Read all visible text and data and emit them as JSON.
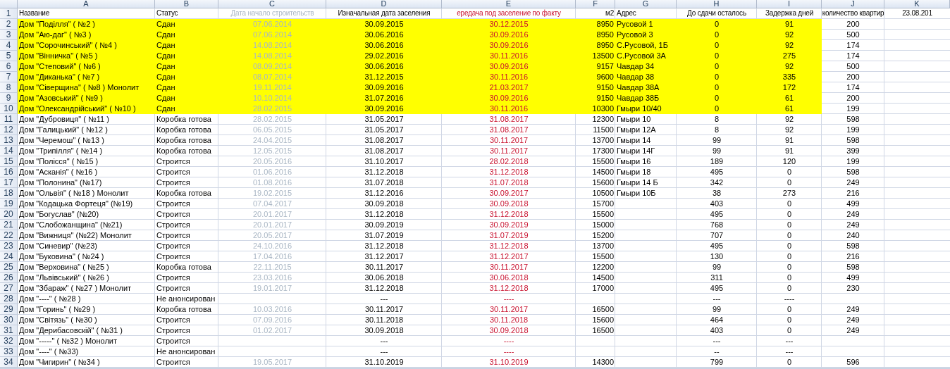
{
  "columns": [
    "A",
    "B",
    "C",
    "D",
    "E",
    "F",
    "G",
    "H",
    "I",
    "J",
    "K"
  ],
  "header": {
    "n": "1",
    "name": "Название",
    "status": "Статус",
    "start": "Дата начало строительств",
    "planned": "Изначальная дата заселения",
    "actual": "ередача под заселение по факту",
    "m2": "м2",
    "address": "Адрес",
    "remaining": "До сдачи осталось",
    "delay": "Задержка дней",
    "flats": "количество квартир",
    "k": "23.08.201"
  },
  "rows": [
    {
      "n": "2",
      "highlighted": true,
      "name": "Дом \"Поділля\" ( №2 )",
      "status": "Сдан",
      "start": "07.06.2014",
      "planned": "30.09.2015",
      "actual": "30.12.2015",
      "m2": "8950",
      "address": "Русовой 1",
      "remaining": "0",
      "delay": "91",
      "flats": "200"
    },
    {
      "n": "3",
      "highlighted": true,
      "name": "Дом \"Аю-даг\" ( №3 )",
      "status": "Сдан",
      "start": "07.06.2014",
      "planned": "30.06.2016",
      "actual": "30.09.2016",
      "m2": "8950",
      "address": "Русовой 3",
      "remaining": "0",
      "delay": "92",
      "flats": "500"
    },
    {
      "n": "4",
      "highlighted": true,
      "name": "Дом \"Сорочинський\" ( №4 )",
      "status": "Сдан",
      "start": "14.08.2014",
      "planned": "30.06.2016",
      "actual": "30.09.2016",
      "m2": "8950",
      "address": "С.Русовой, 1Б",
      "remaining": "0",
      "delay": "92",
      "flats": "174"
    },
    {
      "n": "5",
      "highlighted": true,
      "name": "Дом \"Вінничка\" ( №5 )",
      "status": "Сдан",
      "start": "14.08.2014",
      "planned": "29.02.2016",
      "actual": "30.11.2016",
      "m2": "13500",
      "address": "С.Русовой 3А",
      "remaining": "0",
      "delay": "275",
      "flats": "174"
    },
    {
      "n": "6",
      "highlighted": true,
      "name": "Дом \"Степовий\" ( №6 )",
      "status": "Сдан",
      "start": "08.09.2014",
      "planned": "30.06.2016",
      "actual": "30.09.2016",
      "m2": "9157",
      "address": "Чавдар 34",
      "remaining": "0",
      "delay": "92",
      "flats": "500"
    },
    {
      "n": "7",
      "highlighted": true,
      "name": "Дом \"Диканька\" ( №7 )",
      "status": "Сдан",
      "start": "08.07.2014",
      "planned": "31.12.2015",
      "actual": "30.11.2016",
      "m2": "9600",
      "address": "Чавдар 38",
      "remaining": "0",
      "delay": "335",
      "flats": "200"
    },
    {
      "n": "8",
      "highlighted": true,
      "name": "Дом \"Сіверщина\" ( №8 ) Монолит",
      "status": "Сдан",
      "start": "19.11.2014",
      "planned": "30.09.2016",
      "actual": "21.03.2017",
      "m2": "9150",
      "address": "Чавдар 38А",
      "remaining": "0",
      "delay": "172",
      "flats": "174"
    },
    {
      "n": "9",
      "highlighted": true,
      "name": "Дом \"Азовський\" ( №9 )",
      "status": "Сдан",
      "start": "10.10.2014",
      "planned": "31.07.2016",
      "actual": "30.09.2016",
      "m2": "9150",
      "address": "Чавдар 38Б",
      "remaining": "0",
      "delay": "61",
      "flats": "200"
    },
    {
      "n": "10",
      "highlighted": true,
      "name": "Дом \"Олександрійський\" ( №10 )",
      "status": "Сдан",
      "start": "28.02.2015",
      "planned": "30.09.2016",
      "actual": "30.11.2016",
      "m2": "10300",
      "address": "Гмыри 10/40",
      "remaining": "0",
      "delay": "61",
      "flats": "199"
    },
    {
      "n": "11",
      "highlighted": false,
      "name": "Дом \"Дубровиця\" ( №11 )",
      "status": "Коробка готова",
      "start": "28.02.2015",
      "planned": "31.05.2017",
      "actual": "31.08.2017",
      "m2": "12300",
      "address": "Гмыри 10",
      "remaining": "8",
      "delay": "92",
      "flats": "598"
    },
    {
      "n": "12",
      "highlighted": false,
      "name": "Дом \"Галицький\" ( №12 )",
      "status": "Коробка готова",
      "start": "06.05.2015",
      "planned": "31.05.2017",
      "actual": "31.08.2017",
      "m2": "11500",
      "address": "Гмыри 12А",
      "remaining": "8",
      "delay": "92",
      "flats": "199"
    },
    {
      "n": "13",
      "highlighted": false,
      "name": "Дом \"Черемош\" ( №13 )",
      "status": "Коробка готова",
      "start": "24.04.2015",
      "planned": "31.08.2017",
      "actual": "30.11.2017",
      "m2": "13700",
      "address": "Гмыри 14",
      "remaining": "99",
      "delay": "91",
      "flats": "598"
    },
    {
      "n": "14",
      "highlighted": false,
      "name": "Дом \"Трипілля\" ( №14 )",
      "status": "Коробка готова",
      "start": "12.05.2015",
      "planned": "31.08.2017",
      "actual": "30.11.2017",
      "m2": "17300",
      "address": "Гмыри 14Г",
      "remaining": "99",
      "delay": "91",
      "flats": "399"
    },
    {
      "n": "15",
      "highlighted": false,
      "name": "Дом \"Полісся\" ( №15 )",
      "status": "Строится",
      "start": "20.05.2016",
      "planned": "31.10.2017",
      "actual": "28.02.2018",
      "m2": "15500",
      "address": "Гмыри 16",
      "remaining": "189",
      "delay": "120",
      "flats": "199"
    },
    {
      "n": "16",
      "highlighted": false,
      "name": "Дом \"Асканія\" ( №16 )",
      "status": "Строится",
      "start": "01.06.2016",
      "planned": "31.12.2018",
      "actual": "31.12.2018",
      "m2": "14500",
      "address": "Гмыри 18",
      "remaining": "495",
      "delay": "0",
      "flats": "598"
    },
    {
      "n": "17",
      "highlighted": false,
      "name": "Дом \"Полонина\" (№17)",
      "status": "Строится",
      "start": "01.08.2016",
      "planned": "31.07.2018",
      "actual": "31.07.2018",
      "m2": "15600",
      "address": "Гмыри 14 Б",
      "remaining": "342",
      "delay": "0",
      "flats": "249"
    },
    {
      "n": "18",
      "highlighted": false,
      "name": "Дом \"Ольвія\" ( №18 ) Монолит",
      "status": "Коробка готова",
      "start": "19.02.2015",
      "planned": "31.12.2016",
      "actual": "30.09.2017",
      "m2": "10500",
      "address": "Гмыри 10Б",
      "remaining": "38",
      "delay": "273",
      "flats": "216"
    },
    {
      "n": "19",
      "highlighted": false,
      "name": "Дом \"Кодацька Фортеця\" (№19)",
      "status": "Строится",
      "start": "07.04.2017",
      "planned": "30.09.2018",
      "actual": "30.09.2018",
      "m2": "15700",
      "remaining": "403",
      "delay": "0",
      "flats": "499"
    },
    {
      "n": "20",
      "highlighted": false,
      "name": "Дом \"Богуслав\" (№20)",
      "status": "Строится",
      "start": "20.01.2017",
      "planned": "31.12.2018",
      "actual": "31.12.2018",
      "m2": "15500",
      "remaining": "495",
      "delay": "0",
      "flats": "249"
    },
    {
      "n": "21",
      "highlighted": false,
      "name": "Дом \"Слобожанщина\" (№21)",
      "status": "Строится",
      "start": "20.01.2017",
      "planned": "30.09.2019",
      "actual": "30.09.2019",
      "m2": "15000",
      "remaining": "768",
      "delay": "0",
      "flats": "249"
    },
    {
      "n": "22",
      "highlighted": false,
      "name": "Дом \"Вижниця\" (№22) Монолит",
      "status": "Строится",
      "start": "20.05.2017",
      "planned": "31.07.2019",
      "actual": "31.07.2019",
      "m2": "15200",
      "remaining": "707",
      "delay": "0",
      "flats": "240"
    },
    {
      "n": "23",
      "highlighted": false,
      "name": "Дом \"Синевир\" (№23)",
      "status": "Строится",
      "start": "24.10.2016",
      "planned": "31.12.2018",
      "actual": "31.12.2018",
      "m2": "13700",
      "remaining": "495",
      "delay": "0",
      "flats": "598"
    },
    {
      "n": "24",
      "highlighted": false,
      "name": "Дом \"Буковина\" ( №24 )",
      "status": "Строится",
      "start": "17.04.2016",
      "planned": "31.12.2017",
      "actual": "31.12.2017",
      "m2": "15500",
      "remaining": "130",
      "delay": "0",
      "flats": "216"
    },
    {
      "n": "25",
      "highlighted": false,
      "name": "Дом \"Верховина\" ( №25 )",
      "status": "Коробка готова",
      "start": "22.11.2015",
      "planned": "30.11.2017",
      "actual": "30.11.2017",
      "m2": "12200",
      "remaining": "99",
      "delay": "0",
      "flats": "598"
    },
    {
      "n": "26",
      "highlighted": false,
      "name": "Дом \"Львівський\" ( №26 )",
      "status": "Строится",
      "start": "23.03.2016",
      "planned": "30.06.2018",
      "actual": "30.06.2018",
      "m2": "14500",
      "remaining": "311",
      "delay": "0",
      "flats": "499"
    },
    {
      "n": "27",
      "highlighted": false,
      "name": "Дом \"Збараж\" ( №27 ) Монолит",
      "status": "Строится",
      "start": "19.01.2017",
      "planned": "31.12.2018",
      "actual": "31.12.2018",
      "m2": "17000",
      "remaining": "495",
      "delay": "0",
      "flats": "230"
    },
    {
      "n": "28",
      "highlighted": false,
      "name": "Дом \"----\" ( №28 )",
      "status": "Не анонсирован",
      "planned": "---",
      "actual": "----",
      "remaining": "---",
      "delay": "----"
    },
    {
      "n": "29",
      "highlighted": false,
      "name": "Дом \"Горинь\" ( №29 )",
      "status": "Коробка готова",
      "start": "10.03.2016",
      "planned": "30.11.2017",
      "actual": "30.11.2017",
      "m2": "16500",
      "remaining": "99",
      "delay": "0",
      "flats": "249"
    },
    {
      "n": "30",
      "highlighted": false,
      "name": "Дом \"Світязь\" ( №30 )",
      "status": "Строится",
      "start": "07.09.2016",
      "planned": "30.11.2018",
      "actual": "30.11.2018",
      "m2": "15600",
      "remaining": "464",
      "delay": "0",
      "flats": "249"
    },
    {
      "n": "31",
      "highlighted": false,
      "name": "Дом \"Дерибасовскій\" ( №31 )",
      "status": "Строится",
      "start": "01.02.2017",
      "planned": "30.09.2018",
      "actual": "30.09.2018",
      "m2": "16500",
      "remaining": "403",
      "delay": "0",
      "flats": "249"
    },
    {
      "n": "32",
      "highlighted": false,
      "name": "Дом \"-----\" ( №32 ) Монолит",
      "status": "Строится",
      "planned": "---",
      "actual": "----",
      "remaining": "---",
      "delay": "---"
    },
    {
      "n": "33",
      "highlighted": false,
      "name": "Дом \"----\" ( №33)",
      "status": "Не анонсирован",
      "planned": "---",
      "actual": "----",
      "remaining": "--",
      "delay": "---"
    },
    {
      "n": "34",
      "highlighted": false,
      "name": "Дом \"Чигирин\"  ( №34 )",
      "status": "Строится",
      "start": "19.05.2017",
      "planned": "31.10.2019",
      "actual": "31.10.2019",
      "m2": "14300",
      "remaining": "799",
      "delay": "0",
      "flats": "596"
    }
  ]
}
